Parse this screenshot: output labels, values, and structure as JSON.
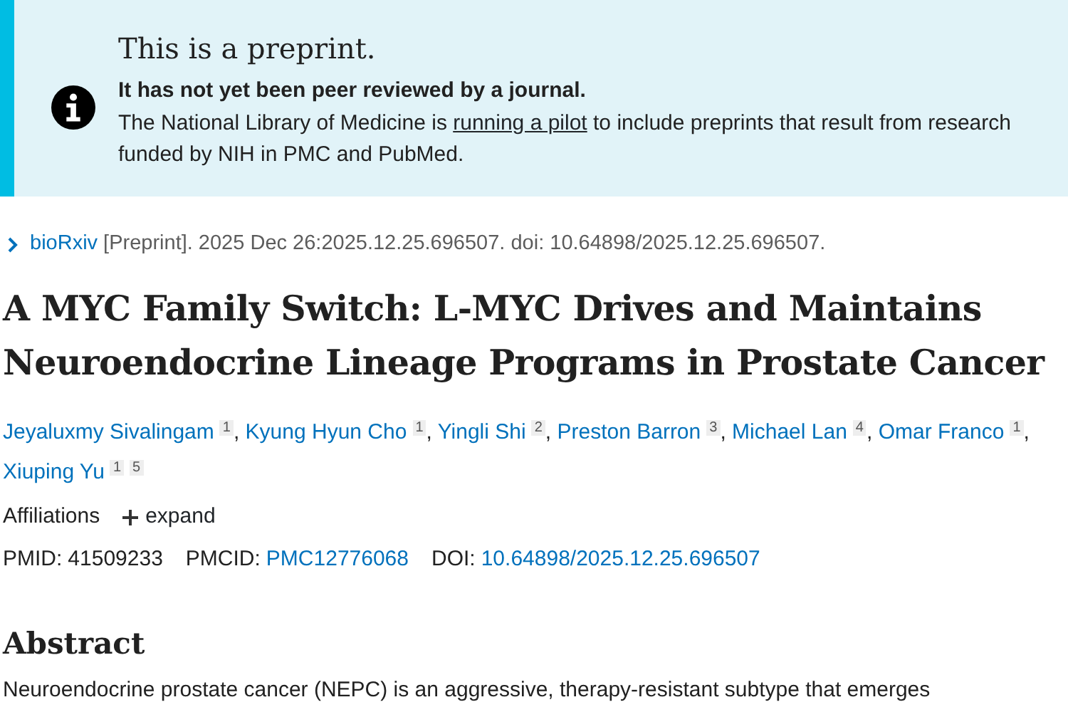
{
  "notice": {
    "title": "This is a preprint.",
    "subtitle": "It has not yet been peer reviewed by a journal.",
    "text_before": "The National Library of Medicine is",
    "link": "running a pilot",
    "text_after": "to include preprints that result from research funded by NIH in PMC and PubMed."
  },
  "citation": {
    "source": "bioRxiv",
    "text": "[Preprint]. 2025 Dec 26:2025.12.25.696507. doi: 10.64898/2025.12.25.696507."
  },
  "title": "A MYC Family Switch: L-MYC Drives and Maintains Neuroendocrine Lineage Programs in Prostate Cancer",
  "authors": [
    {
      "name": "Jeyaluxmy Sivalingam",
      "affiliations": [
        "1"
      ],
      "separator": ","
    },
    {
      "name": "Kyung Hyun Cho",
      "affiliations": [
        "1"
      ],
      "separator": ","
    },
    {
      "name": "Yingli Shi",
      "affiliations": [
        "2"
      ],
      "separator": ","
    },
    {
      "name": "Preston Barron",
      "affiliations": [
        "3"
      ],
      "separator": ","
    },
    {
      "name": "Michael Lan",
      "affiliations": [
        "4"
      ],
      "separator": ","
    },
    {
      "name": "Omar Franco",
      "affiliations": [
        "1"
      ],
      "separator": ","
    },
    {
      "name": "Xiuping Yu",
      "affiliations": [
        "1",
        "5"
      ]
    }
  ],
  "affiliations": {
    "label": "Affiliations",
    "toggle": "expand",
    "expanded": false
  },
  "identifiers": [
    {
      "label": "PMID:",
      "value": "41509233",
      "kind": "text"
    },
    {
      "label": "PMCID:",
      "value": "PMC12776068",
      "kind": "link"
    },
    {
      "label": "DOI:",
      "value": "10.64898/2025.12.25.696507",
      "kind": "link"
    }
  ],
  "abstract": {
    "heading": "Abstract",
    "text": "Neuroendocrine prostate cancer (NEPC) is an aggressive, therapy-resistant subtype that emerges"
  }
}
